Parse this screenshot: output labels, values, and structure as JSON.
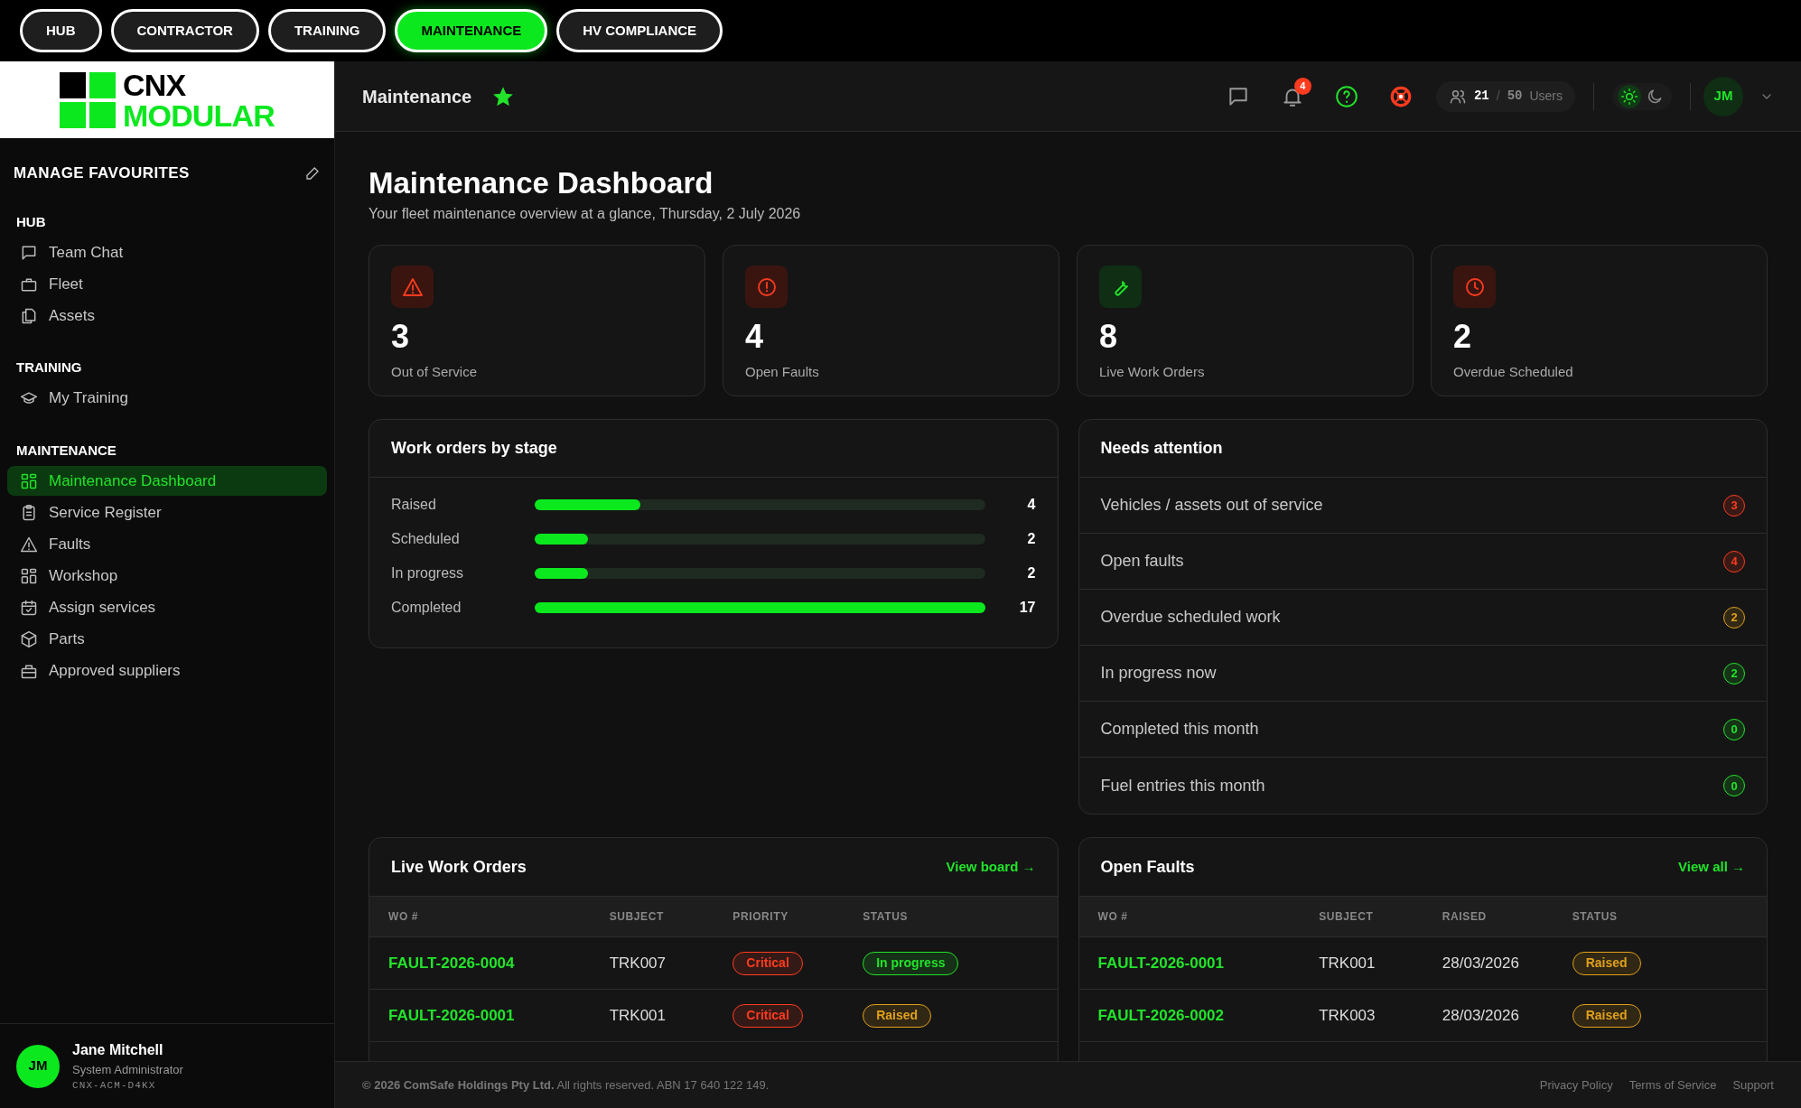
{
  "top_tabs": [
    {
      "label": "HUB",
      "selected": false
    },
    {
      "label": "CONTRACTOR",
      "selected": false
    },
    {
      "label": "TRAINING",
      "selected": false
    },
    {
      "label": "MAINTENANCE",
      "selected": true
    },
    {
      "label": "HV COMPLIANCE",
      "selected": false
    }
  ],
  "logo": {
    "line1": "CNX",
    "line2": "MODULAR"
  },
  "sidebar": {
    "title": "MANAGE FAVOURITES",
    "sections": [
      {
        "heading": "HUB",
        "items": [
          {
            "label": "Team Chat",
            "kind": "chat",
            "selected": false
          },
          {
            "label": "Fleet",
            "kind": "briefcase",
            "selected": false
          },
          {
            "label": "Assets",
            "kind": "copy",
            "selected": false
          }
        ]
      },
      {
        "heading": "TRAINING",
        "items": [
          {
            "label": "My Training",
            "kind": "cap",
            "selected": false
          }
        ]
      },
      {
        "heading": "MAINTENANCE",
        "items": [
          {
            "label": "Maintenance Dashboard",
            "kind": "grid",
            "selected": true
          },
          {
            "label": "Service Register",
            "kind": "clipboard",
            "selected": false
          },
          {
            "label": "Faults",
            "kind": "warning",
            "selected": false
          },
          {
            "label": "Workshop",
            "kind": "grid",
            "selected": false
          },
          {
            "label": "Assign services",
            "kind": "calendar",
            "selected": false
          },
          {
            "label": "Parts",
            "kind": "package",
            "selected": false
          },
          {
            "label": "Approved suppliers",
            "kind": "tray",
            "selected": false
          }
        ]
      }
    ],
    "user": {
      "initials": "JM",
      "name": "Jane Mitchell",
      "role": "System Administrator",
      "code": "CNX-ACM-D4KX"
    }
  },
  "header": {
    "title": "Maintenance",
    "favourite": true,
    "notifications": "4",
    "users_current": "21",
    "users_sep": "/",
    "users_max": "50",
    "users_label": "Users",
    "light_theme": true,
    "avatar": "JM"
  },
  "page": {
    "title": "Maintenance Dashboard",
    "subtitle": "Your fleet maintenance overview at a glance, Thursday, 2 July 2026"
  },
  "stats": [
    {
      "value": "3",
      "label": "Out of Service",
      "kind": "warning"
    },
    {
      "value": "4",
      "label": "Open Faults",
      "kind": "alert"
    },
    {
      "value": "8",
      "label": "Live Work Orders",
      "kind": "wrench"
    },
    {
      "value": "2",
      "label": "Overdue Scheduled",
      "kind": "clock"
    }
  ],
  "stages": {
    "title": "Work orders by stage",
    "rows": [
      {
        "label": "Raised",
        "level": 0.235,
        "count": "4"
      },
      {
        "label": "Scheduled",
        "level": 0.118,
        "count": "2"
      },
      {
        "label": "In progress",
        "level": 0.118,
        "count": "2"
      },
      {
        "label": "Completed",
        "level": 1,
        "count": "17"
      }
    ]
  },
  "attention": {
    "title": "Needs attention",
    "rows": [
      {
        "label": "Vehicles / assets out of service",
        "count": "3",
        "color": "#ff3b1f"
      },
      {
        "label": "Open faults",
        "count": "4",
        "color": "#ff3b1f"
      },
      {
        "label": "Overdue scheduled work",
        "count": "2",
        "color": "#e0a01a"
      },
      {
        "label": "In progress now",
        "count": "2",
        "color": "#22e32a"
      },
      {
        "label": "Completed this month",
        "count": "0",
        "color": "#22e32a"
      },
      {
        "label": "Fuel entries this month",
        "count": "0",
        "color": "#22e32a"
      }
    ]
  },
  "live_work_orders": {
    "title": "Live Work Orders",
    "link": "View board →",
    "columns": [
      "WO #",
      "SUBJECT",
      "PRIORITY",
      "STATUS"
    ],
    "rows": [
      {
        "wo": "FAULT-2026-0004",
        "subject": "TRK007",
        "c3": {
          "text": "Critical",
          "color": "#ff3b1f"
        },
        "c4": {
          "text": "In progress",
          "color": "#22e32a"
        }
      },
      {
        "wo": "FAULT-2026-0001",
        "subject": "TRK001",
        "c3": {
          "text": "Critical",
          "color": "#ff3b1f"
        },
        "c4": {
          "text": "Raised",
          "color": "#e0a01a"
        }
      }
    ]
  },
  "open_faults": {
    "title": "Open Faults",
    "link": "View all →",
    "columns": [
      "WO #",
      "SUBJECT",
      "RAISED",
      "STATUS"
    ],
    "rows": [
      {
        "wo": "FAULT-2026-0001",
        "subject": "TRK001",
        "c3": {
          "text": "28/03/2026"
        },
        "c4": {
          "text": "Raised",
          "color": "#e0a01a"
        }
      },
      {
        "wo": "FAULT-2026-0002",
        "subject": "TRK003",
        "c3": {
          "text": "28/03/2026"
        },
        "c4": {
          "text": "Raised",
          "color": "#e0a01a"
        }
      }
    ]
  },
  "footer": {
    "copyright": "**© 2026 ComSafe Holdings Pty Ltd.** All rights reserved. ABN 17 640 122 149.",
    "links": [
      "Privacy Policy",
      "Terms of Service",
      "Support"
    ]
  }
}
